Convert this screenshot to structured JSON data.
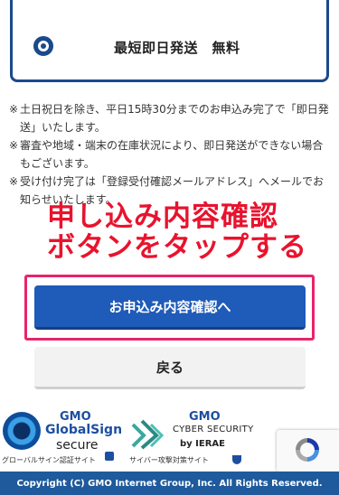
{
  "shipping": {
    "option_label": "最短即日発送　無料"
  },
  "notes": [
    {
      "mark": "※",
      "text": "土日祝日を除き、平日15時30分までのお申込み完了で「即日発送」いたします。"
    },
    {
      "mark": "※",
      "text": "審査や地域・端末の在庫状況により、即日発送ができない場合もございます。"
    },
    {
      "mark": "※",
      "text": "受け付け完了は「登録受付確認メールアドレス」へメールでお知らせいたします。"
    }
  ],
  "annotation": {
    "line1": "申し込み内容確認",
    "line2": "ボタンをタップする",
    "color": "#e8132e"
  },
  "buttons": {
    "confirm_label": "お申込み内容確認へ",
    "back_label": "戻る"
  },
  "badges": {
    "globalsign": {
      "brand": "GMO",
      "name": "GlobalSign",
      "secure": "secure",
      "caption": "グローバルサイン認証サイト"
    },
    "cybersecurity": {
      "brand": "GMO",
      "name": "CYBER SECURITY",
      "by": "by IERAE",
      "caption": "サイバー攻撃対策サイト"
    }
  },
  "footer": {
    "copyright": "Copyright (C) GMO Internet Group, Inc. All Rights Reserved."
  },
  "colors": {
    "brand_blue": "#1f5bb8",
    "highlight_pink": "#e8246a",
    "footer_blue": "#1e5a9c"
  }
}
